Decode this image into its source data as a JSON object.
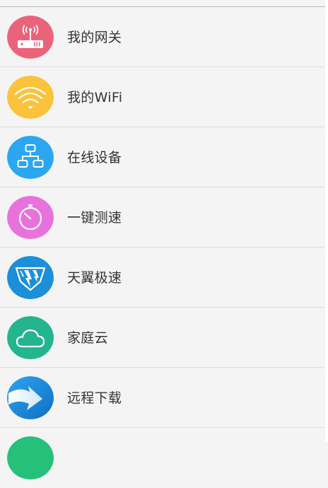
{
  "menu": {
    "items": [
      {
        "label": "我的网关",
        "icon": "router-icon",
        "color": "#e9647a"
      },
      {
        "label": "我的WiFi",
        "icon": "wifi-icon",
        "color": "#fbc23b"
      },
      {
        "label": "在线设备",
        "icon": "network-devices-icon",
        "color": "#2aa7f0"
      },
      {
        "label": "一键测速",
        "icon": "speed-test-icon",
        "color": "#e872dc"
      },
      {
        "label": "天翼极速",
        "icon": "tianyi-speed-icon",
        "color": "#1b8fd8"
      },
      {
        "label": "家庭云",
        "icon": "cloud-icon",
        "color": "#24b48e"
      },
      {
        "label": "远程下载",
        "icon": "remote-download-icon",
        "color": "#1480d0"
      },
      {
        "label": "",
        "icon": "partial-icon",
        "color": "#25c07a"
      }
    ]
  }
}
